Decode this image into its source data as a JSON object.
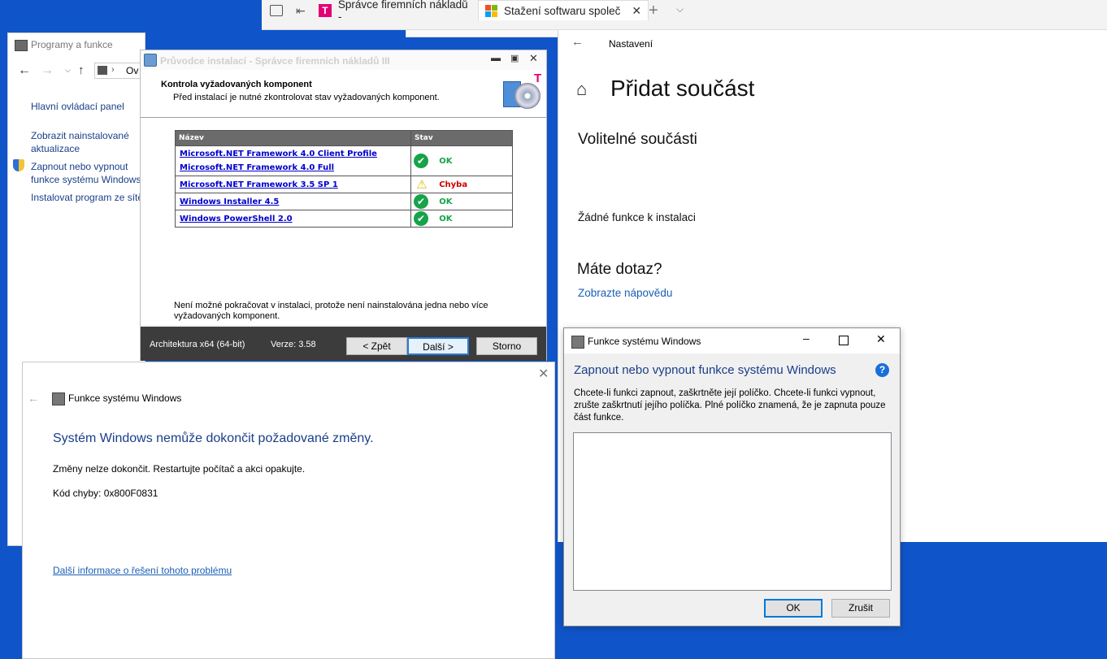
{
  "browser": {
    "tabs": [
      {
        "label": "Správce firemních nákladů -"
      },
      {
        "label": "Stažení softwaru společ"
      }
    ],
    "new_tab_symbol": "+"
  },
  "programs_window": {
    "title": "Programy a funkce",
    "address_fragment": "Ov",
    "sidebar": [
      {
        "label": "Hlavní ovládací panel"
      },
      {
        "label": "Zobrazit nainstalované aktualizace"
      },
      {
        "label": "Zapnout nebo vypnout funkce systému Windows"
      },
      {
        "label": "Instalovat program ze sítě"
      }
    ]
  },
  "settings": {
    "title": "Nastavení",
    "heading": "Přidat součást",
    "section": "Volitelné součásti",
    "empty_text": "Žádné funkce k instalaci",
    "question": "Máte dotaz?",
    "help_link": "Zobrazte nápovědu"
  },
  "wizard": {
    "title": "Průvodce instalací - Správce firemních nákladů III",
    "header_title": "Kontrola vyžadovaných komponent",
    "header_subtitle": "Před instalací je nutné zkontrolovat stav vyžadovaných komponent.",
    "logo_letter": "T",
    "table": {
      "col_name": "Název",
      "col_status": "Stav",
      "rows": [
        {
          "names": [
            "Microsoft.NET Framework 4.0 Client Profile",
            "Microsoft.NET Framework 4.0 Full"
          ],
          "status": "OK",
          "state": "ok"
        },
        {
          "names": [
            "Microsoft.NET Framework 3.5 SP 1"
          ],
          "status": "Chyba",
          "state": "error"
        },
        {
          "names": [
            "Windows Installer 4.5"
          ],
          "status": "OK",
          "state": "ok"
        },
        {
          "names": [
            "Windows PowerShell 2.0"
          ],
          "status": "OK",
          "state": "ok"
        }
      ]
    },
    "message": "Není možné pokračovat v instalaci, protože není nainstalována jedna nebo více vyžadovaných komponent.",
    "arch": "Architektura x64 (64-bit)",
    "version": "Verze: 3.58",
    "buttons": {
      "back": "< Zpět",
      "next": "Další >",
      "cancel": "Storno"
    }
  },
  "error_dialog": {
    "title": "Funkce systému Windows",
    "heading": "Systém Windows nemůže dokončit požadované změny.",
    "text": "Změny nelze dokončit. Restartujte počítač a akci opakujte.",
    "code": "Kód chyby: 0x800F0831",
    "link": "Další informace o řešení tohoto problému"
  },
  "features_dialog": {
    "title": "Funkce systému Windows",
    "heading": "Zapnout nebo vypnout funkce systému Windows",
    "description": "Chcete-li funkci zapnout, zaškrtněte její políčko. Chcete-li funkci vypnout, zrušte zaškrtnutí jejího políčka. Plné políčko znamená, že je zapnuta pouze část funkce.",
    "ok": "OK",
    "cancel": "Zrušit"
  },
  "colors": {
    "desktop": "#0f55c9",
    "link_blue": "#1a5fb4",
    "ok_green": "#16a34a",
    "error_red": "#cc0000",
    "tmobile_magenta": "#e20074"
  }
}
